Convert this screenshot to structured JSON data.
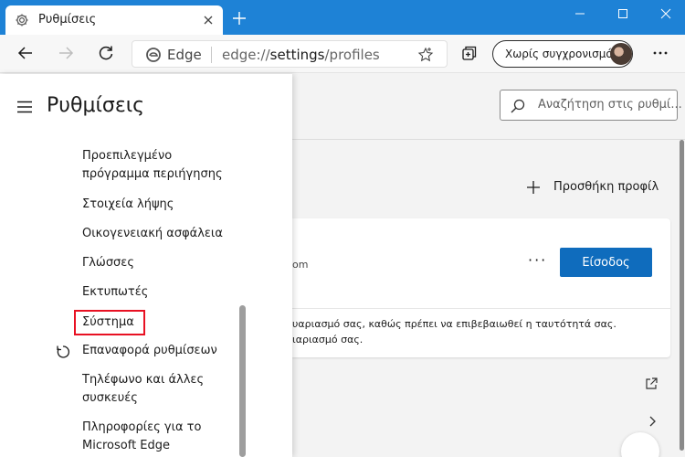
{
  "browser": {
    "tab_title": "Ρυθμίσεις",
    "address_brand": "Edge",
    "address_url_prefix": "edge://",
    "address_url_strong": "settings",
    "address_url_suffix": "/profiles",
    "sync_label": "Χωρίς συγχρονισμό"
  },
  "sidepanel": {
    "title": "Ρυθμίσεις",
    "items": [
      {
        "label": "Προεπιλεγμένο πρόγραμμα περιήγησης"
      },
      {
        "label": "Στοιχεία λήψης"
      },
      {
        "label": "Οικογενειακή ασφάλεια"
      },
      {
        "label": "Γλώσσες"
      },
      {
        "label": "Εκτυπωτές"
      },
      {
        "label": "Σύστημα"
      },
      {
        "label": "Επαναφορά ρυθμίσεων",
        "icon": "reset-icon"
      },
      {
        "label": "Τηλέφωνο και άλλες συσκευές"
      },
      {
        "label": "Πληροφορίες για το Microsoft Edge"
      }
    ]
  },
  "content": {
    "search_placeholder": "Αναζήτηση στις ρυθμί...",
    "add_profile_label": "Προσθήκη προφίλ",
    "email_fragment": "om",
    "more_label": "···",
    "signin_label": "Είσοδος",
    "notice_line1": "υαριασμό σας, καθώς πρέπει να επιβεβαιωθεί η ταυτότητά σας.",
    "notice_line2": "ιαριασμό σας."
  },
  "colors": {
    "accent": "#1e82d6",
    "primary_button": "#0f6cbd",
    "highlight": "#e81123"
  }
}
